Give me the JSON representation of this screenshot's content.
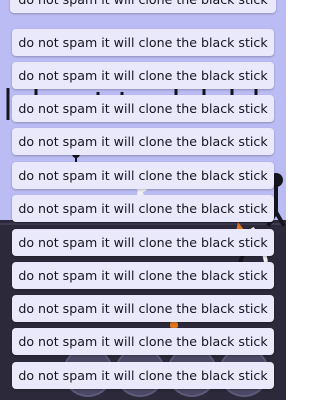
{
  "colors": {
    "sky": "#bcbcf4",
    "ground": "#2c2a3a",
    "toast_bg": "#e9e9fb",
    "toast_text": "#15151f",
    "accent_orange": "#e2761e",
    "stick": "#15151f"
  },
  "toasts": [
    {
      "text": "do not spam it will clone the black stick"
    },
    {
      "text": "do not spam it will clone the black stick"
    },
    {
      "text": "do not spam it will clone the black stick"
    },
    {
      "text": "do not spam it will clone the black stick"
    },
    {
      "text": "do not spam it will clone the black stick"
    },
    {
      "text": "do not spam it will clone the black stick"
    },
    {
      "text": "do not spam it will clone the black stick"
    },
    {
      "text": "do not spam it will clone the black stick"
    },
    {
      "text": "do not spam it will clone the black stick"
    },
    {
      "text": "do not spam it will clone the black stick"
    },
    {
      "text": "do not spam it will clone the black stick"
    },
    {
      "text": "do not spam it will clone the black stick"
    }
  ]
}
